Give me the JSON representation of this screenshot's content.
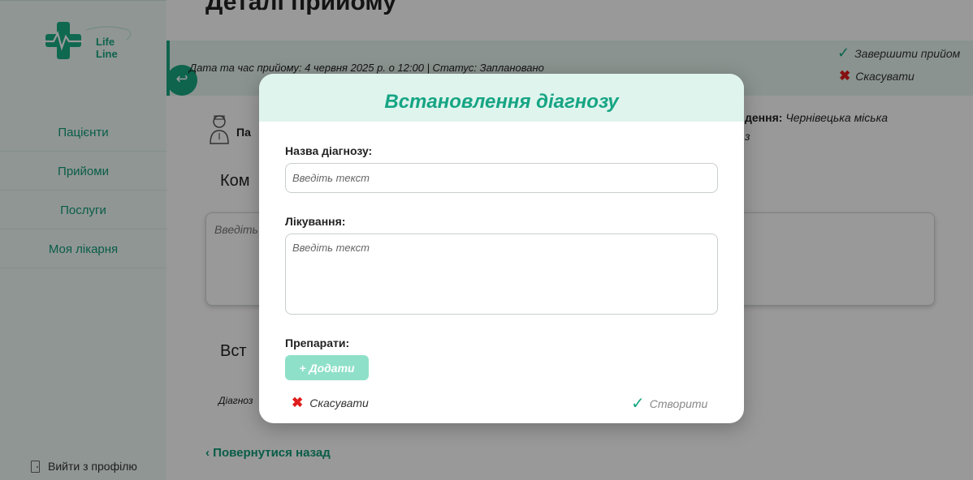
{
  "sidebar": {
    "logo_text_1": "Life",
    "logo_text_2": "Line",
    "items": [
      {
        "label": "Пацієнти"
      },
      {
        "label": "Прийоми"
      },
      {
        "label": "Послуги"
      },
      {
        "label": "Моя лікарня"
      }
    ],
    "logout_label": "Вийти з профілю"
  },
  "page": {
    "title": "Деталі прийому",
    "info_line": "Дата та час прийому: 4 червня 2025 р. о 12:00 | Статус: Заплановано",
    "complete_label": "Завершити прийом",
    "cancel_label": "Скасувати",
    "doctor_initial": "Па",
    "hospital_label_suffix": "дення:",
    "hospital_value": "Чернівецька міська",
    "hospital_line2": "з",
    "comment_heading": "Ком",
    "comment_placeholder": "Введіть",
    "establish_heading": "Вст",
    "diagnosis_label": "Діагноз",
    "back_link": "‹ Повернутися назад"
  },
  "modal": {
    "title": "Встановлення діагнозу",
    "diagnosis_name_label": "Назва діагнозу:",
    "diagnosis_placeholder": "Введіть текст",
    "treatment_label": "Лікування:",
    "treatment_placeholder": "Введіть текст",
    "drugs_label": "Препарати:",
    "add_label": "+ Додати",
    "cancel_label": "Скасувати",
    "create_label": "Створити"
  },
  "colors": {
    "accent": "#18a781",
    "header_bg": "#dff4ed",
    "cancel_red": "#e01c1c"
  }
}
